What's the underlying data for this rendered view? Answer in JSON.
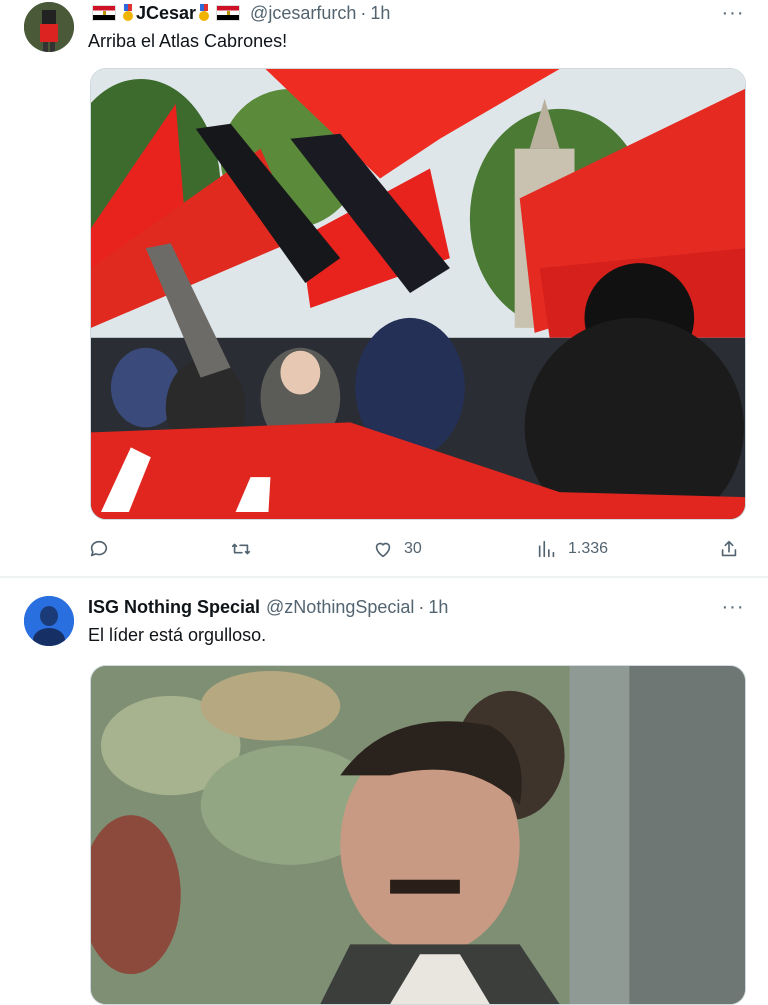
{
  "tweets": [
    {
      "display_name": "JCesar",
      "handle": "@jcesarfurch",
      "separator": "·",
      "time": "1h",
      "text": "Arriba el Atlas Cabrones!",
      "more_label": "···",
      "actions": {
        "reply_count": "",
        "retweet_count": "",
        "like_count": "30",
        "view_count": "1.336"
      }
    },
    {
      "display_name": "ISG Nothing Special",
      "handle": "@zNothingSpecial",
      "separator": "·",
      "time": "1h",
      "text": "El líder está orgulloso.",
      "more_label": "···"
    }
  ],
  "icons": {
    "reply": "comment-icon",
    "retweet": "retweet-icon",
    "like": "heart-icon",
    "views": "analytics-icon",
    "share": "share-icon",
    "more": "more-icon",
    "flag": "egypt-flag-icon",
    "medal": "medal-icon"
  },
  "colors": {
    "text_primary": "#0f1419",
    "text_secondary": "#536471",
    "divider": "#eff3f4",
    "flag_red": "#e8231e"
  }
}
